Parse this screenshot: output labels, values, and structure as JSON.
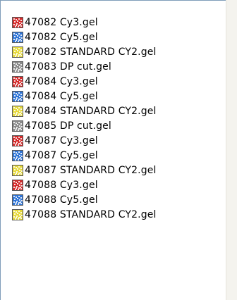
{
  "palette": {
    "red": "#d42a2a",
    "blue": "#2e74d6",
    "yellow": "#e6d93a",
    "gray": "#8a8a8a"
  },
  "files": [
    {
      "name": "47082 Cy3.gel",
      "color": "red",
      "icon": "red-gel-file-icon"
    },
    {
      "name": "47082 Cy5.gel",
      "color": "blue",
      "icon": "blue-gel-file-icon"
    },
    {
      "name": "47082 STANDARD CY2.gel",
      "color": "yellow",
      "icon": "yellow-gel-file-icon"
    },
    {
      "name": "47083 DP cut.gel",
      "color": "gray",
      "icon": "gray-gel-file-icon"
    },
    {
      "name": "47084 Cy3.gel",
      "color": "red",
      "icon": "red-gel-file-icon"
    },
    {
      "name": "47084 Cy5.gel",
      "color": "blue",
      "icon": "blue-gel-file-icon"
    },
    {
      "name": "47084 STANDARD CY2.gel",
      "color": "yellow",
      "icon": "yellow-gel-file-icon"
    },
    {
      "name": "47085 DP cut.gel",
      "color": "gray",
      "icon": "gray-gel-file-icon"
    },
    {
      "name": "47087 Cy3.gel",
      "color": "red",
      "icon": "red-gel-file-icon"
    },
    {
      "name": "47087 Cy5.gel",
      "color": "blue",
      "icon": "blue-gel-file-icon"
    },
    {
      "name": "47087 STANDARD CY2.gel",
      "color": "yellow",
      "icon": "yellow-gel-file-icon"
    },
    {
      "name": "47088 Cy3.gel",
      "color": "red",
      "icon": "red-gel-file-icon"
    },
    {
      "name": "47088 Cy5.gel",
      "color": "blue",
      "icon": "blue-gel-file-icon"
    },
    {
      "name": "47088 STANDARD CY2.gel",
      "color": "yellow",
      "icon": "yellow-gel-file-icon"
    }
  ]
}
